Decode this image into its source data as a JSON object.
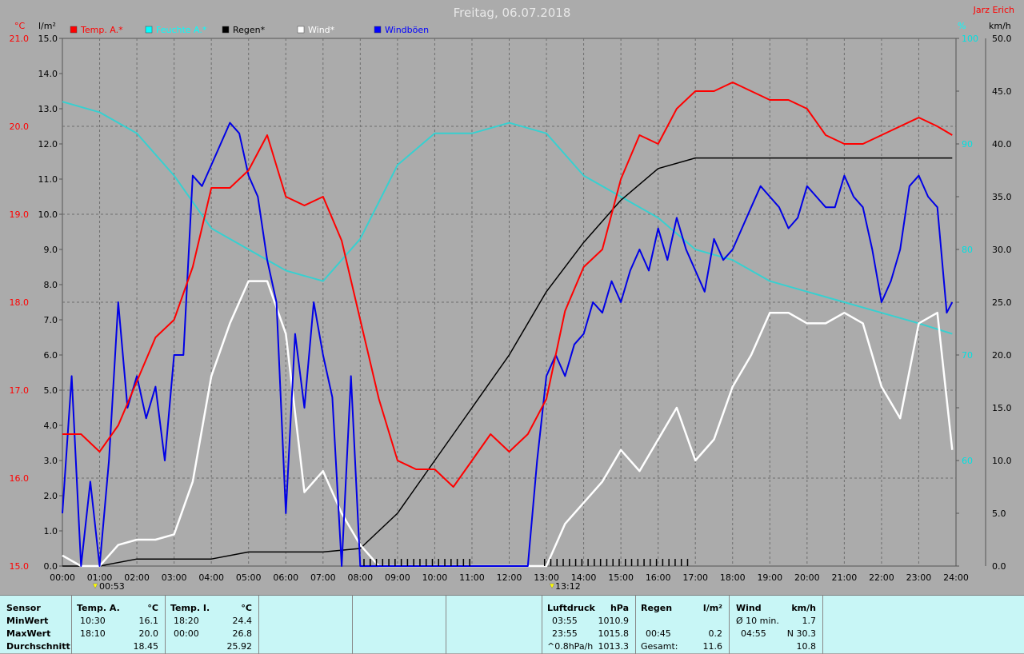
{
  "title": "Freitag, 06.07.2018",
  "author": "Jarz Erich",
  "units": {
    "left_temp": "°C",
    "left_rain": "l/m²",
    "right_hum": "%",
    "right_wind": "km/h"
  },
  "legend": [
    {
      "label": "Temp. A.*",
      "color": "#ff0000"
    },
    {
      "label": "Feuchte A.*",
      "color": "#00ffff"
    },
    {
      "label": "Regen*",
      "color": "#000000"
    },
    {
      "label": "Wind*",
      "color": "#ffffff"
    },
    {
      "label": "Windböen",
      "color": "#0000ff"
    }
  ],
  "marker_labels": [
    "00:53",
    "13:12"
  ],
  "colors": {
    "bg": "#ababab",
    "temp": "#ff0000",
    "hum": "#37d0d0",
    "rain": "#000000",
    "wind": "#ffffff",
    "gust": "#0000e6",
    "stats_bg": "#c8f6f6"
  },
  "chart_data": {
    "type": "line",
    "title": "Freitag, 06.07.2018",
    "x_ticks": [
      "00:00",
      "01:00",
      "02:00",
      "03:00",
      "04:00",
      "05:00",
      "06:00",
      "07:00",
      "08:00",
      "09:00",
      "10:00",
      "11:00",
      "12:00",
      "13:00",
      "14:00",
      "15:00",
      "16:00",
      "17:00",
      "18:00",
      "19:00",
      "20:00",
      "21:00",
      "22:00",
      "23:00",
      "24:00"
    ],
    "axes": {
      "temp_c": {
        "range": [
          15,
          21
        ],
        "ticks": [
          "15.0",
          "16.0",
          "17.0",
          "18.0",
          "19.0",
          "20.0",
          "21.0"
        ]
      },
      "rain_lm2": {
        "range": [
          0,
          15
        ],
        "ticks": [
          "0.0",
          "1.0",
          "2.0",
          "3.0",
          "4.0",
          "5.0",
          "6.0",
          "7.0",
          "8.0",
          "9.0",
          "10.0",
          "11.0",
          "12.0",
          "13.0",
          "14.0",
          "15.0"
        ]
      },
      "hum_pct": {
        "range": [
          50,
          100
        ],
        "ticks": [
          "60",
          "70",
          "80",
          "90",
          "100"
        ]
      },
      "wind_kmh": {
        "range": [
          0,
          50
        ],
        "ticks": [
          "0.0",
          "5.0",
          "10.0",
          "15.0",
          "20.0",
          "25.0",
          "30.0",
          "35.0",
          "40.0",
          "45.0",
          "50.0"
        ]
      }
    },
    "grid": true,
    "series": [
      {
        "name": "Temp. A.*",
        "axis": "temp_c",
        "color": "#ff0000",
        "x": [
          0,
          0.5,
          1,
          1.5,
          2,
          2.5,
          3,
          3.5,
          4,
          4.5,
          5,
          5.5,
          6,
          6.5,
          7,
          7.5,
          8,
          8.5,
          9,
          9.5,
          10,
          10.5,
          11,
          11.5,
          12,
          12.5,
          13,
          13.5,
          14,
          14.5,
          15,
          15.5,
          16,
          16.5,
          17,
          17.5,
          18,
          18.5,
          19,
          19.5,
          20,
          20.5,
          21,
          21.5,
          22,
          22.5,
          23,
          23.5,
          23.9
        ],
        "values": [
          16.5,
          16.5,
          16.3,
          16.6,
          17.1,
          17.6,
          17.8,
          18.4,
          19.3,
          19.3,
          19.5,
          19.9,
          19.2,
          19.1,
          19.2,
          18.7,
          17.8,
          16.9,
          16.2,
          16.1,
          16.1,
          15.9,
          16.2,
          16.5,
          16.3,
          16.5,
          16.9,
          17.9,
          18.4,
          18.6,
          19.4,
          19.9,
          19.8,
          20.2,
          20.4,
          20.4,
          20.5,
          20.4,
          20.3,
          20.3,
          20.2,
          19.9,
          19.8,
          19.8,
          19.9,
          20.0,
          20.1,
          20.0,
          19.9
        ]
      },
      {
        "name": "Feuchte A.*",
        "axis": "hum_pct",
        "color": "#37d0d0",
        "x": [
          0,
          1,
          2,
          3,
          4,
          5,
          6,
          7,
          8,
          9,
          10,
          11,
          12,
          13,
          14,
          15,
          16,
          17,
          18,
          19,
          20,
          21,
          22,
          23,
          23.9
        ],
        "values": [
          94,
          93,
          91,
          87,
          82,
          80,
          78,
          77,
          81,
          88,
          91,
          91,
          92,
          91,
          87,
          85,
          83,
          80,
          79,
          77,
          76,
          75,
          74,
          73,
          72
        ]
      },
      {
        "name": "Regen*",
        "axis": "rain_lm2",
        "color": "#000000",
        "x": [
          0,
          1,
          2,
          3,
          4,
          5,
          6,
          7,
          8,
          9,
          10,
          11,
          12,
          13,
          14,
          15,
          16,
          17,
          18,
          19,
          20,
          21,
          22,
          23,
          23.9
        ],
        "values": [
          0,
          0,
          0.2,
          0.2,
          0.2,
          0.4,
          0.4,
          0.4,
          0.5,
          1.5,
          3,
          4.5,
          6,
          7.8,
          9.2,
          10.4,
          11.3,
          11.6,
          11.6,
          11.6,
          11.6,
          11.6,
          11.6,
          11.6,
          11.6
        ]
      },
      {
        "name": "Wind*",
        "axis": "wind_kmh",
        "color": "#ffffff",
        "x": [
          0,
          0.5,
          1,
          1.5,
          2,
          2.5,
          3,
          3.5,
          4,
          4.5,
          5,
          5.5,
          6,
          6.5,
          7,
          7.5,
          8,
          8.5,
          9,
          9.5,
          10,
          10.5,
          11,
          11.5,
          12,
          12.5,
          13,
          13.5,
          14,
          14.5,
          15,
          15.5,
          16,
          16.5,
          17,
          17.5,
          18,
          18.5,
          19,
          19.5,
          20,
          20.5,
          21,
          21.5,
          22,
          22.5,
          23,
          23.5,
          23.9
        ],
        "values": [
          1,
          0,
          0,
          2,
          2.5,
          2.5,
          3,
          8,
          18,
          23,
          27,
          27,
          22,
          7,
          9,
          5,
          2,
          0,
          0,
          0,
          0,
          0,
          0,
          0,
          0,
          0,
          0,
          4,
          6,
          8,
          11,
          9,
          12,
          15,
          10,
          12,
          17,
          20,
          24,
          24,
          23,
          23,
          24,
          23,
          17,
          14,
          23,
          24,
          11
        ]
      },
      {
        "name": "Windböen",
        "axis": "wind_kmh",
        "color": "#0000e6",
        "x": [
          0,
          0.25,
          0.5,
          0.75,
          1,
          1.25,
          1.5,
          1.75,
          2,
          2.25,
          2.5,
          2.75,
          3,
          3.25,
          3.5,
          3.75,
          4,
          4.25,
          4.5,
          4.75,
          5,
          5.25,
          5.5,
          5.75,
          6,
          6.25,
          6.5,
          6.75,
          7,
          7.25,
          7.5,
          7.75,
          8,
          8.25,
          8.5,
          12.5,
          12.75,
          13,
          13.25,
          13.5,
          13.75,
          14,
          14.25,
          14.5,
          14.75,
          15,
          15.25,
          15.5,
          15.75,
          16,
          16.25,
          16.5,
          16.75,
          17,
          17.25,
          17.5,
          17.75,
          18,
          18.25,
          18.5,
          18.75,
          19,
          19.25,
          19.5,
          19.75,
          20,
          20.25,
          20.5,
          20.75,
          21,
          21.25,
          21.5,
          21.75,
          22,
          22.25,
          22.5,
          22.75,
          23,
          23.25,
          23.5,
          23.75,
          23.9
        ],
        "values": [
          5,
          18,
          0,
          8,
          0,
          10,
          25,
          15,
          18,
          14,
          17,
          10,
          20,
          20,
          37,
          36,
          38,
          40,
          42,
          41,
          37,
          35,
          29,
          25,
          5,
          22,
          15,
          25,
          20,
          16,
          0,
          18,
          0,
          0,
          0,
          0,
          10,
          18,
          20,
          18,
          21,
          22,
          25,
          24,
          27,
          25,
          28,
          30,
          28,
          32,
          29,
          33,
          30,
          28,
          26,
          31,
          29,
          30,
          32,
          34,
          36,
          35,
          34,
          32,
          33,
          36,
          35,
          34,
          34,
          37,
          35,
          34,
          30,
          25,
          27,
          30,
          36,
          37,
          35,
          34,
          24,
          25
        ]
      }
    ]
  },
  "stats": {
    "sensor": {
      "header": "Sensor",
      "rows": [
        "MinWert",
        "MaxWert",
        "Durchschnitt"
      ]
    },
    "temp_a": {
      "header": "Temp. A.",
      "unit": "°C",
      "min_time": "10:30",
      "min": "16.1",
      "max_time": "18:10",
      "max": "20.0",
      "avg": "18.45"
    },
    "temp_i": {
      "header": "Temp. I.",
      "unit": "°C",
      "min_time": "18:20",
      "min": "24.4",
      "max_time": "00:00",
      "max": "26.8",
      "avg": "25.92"
    },
    "pressure": {
      "header": "Luftdruck",
      "unit": "hPa",
      "min_time": "03:55",
      "min": "1010.9",
      "max_time": "23:55",
      "max": "1015.8",
      "avg_label": "^0.8hPa/h",
      "avg": "1013.3"
    },
    "rain": {
      "header": "Regen",
      "unit": "l/m²",
      "max_time": "00:45",
      "max": "0.2",
      "total_label": "Gesamt:",
      "total": "11.6"
    },
    "wind": {
      "header": "Wind",
      "unit": "km/h",
      "min_label": "Ø 10 min.",
      "min": "1.7",
      "max_time": "04:55",
      "max": "N 30.3",
      "avg": "10.8"
    }
  }
}
